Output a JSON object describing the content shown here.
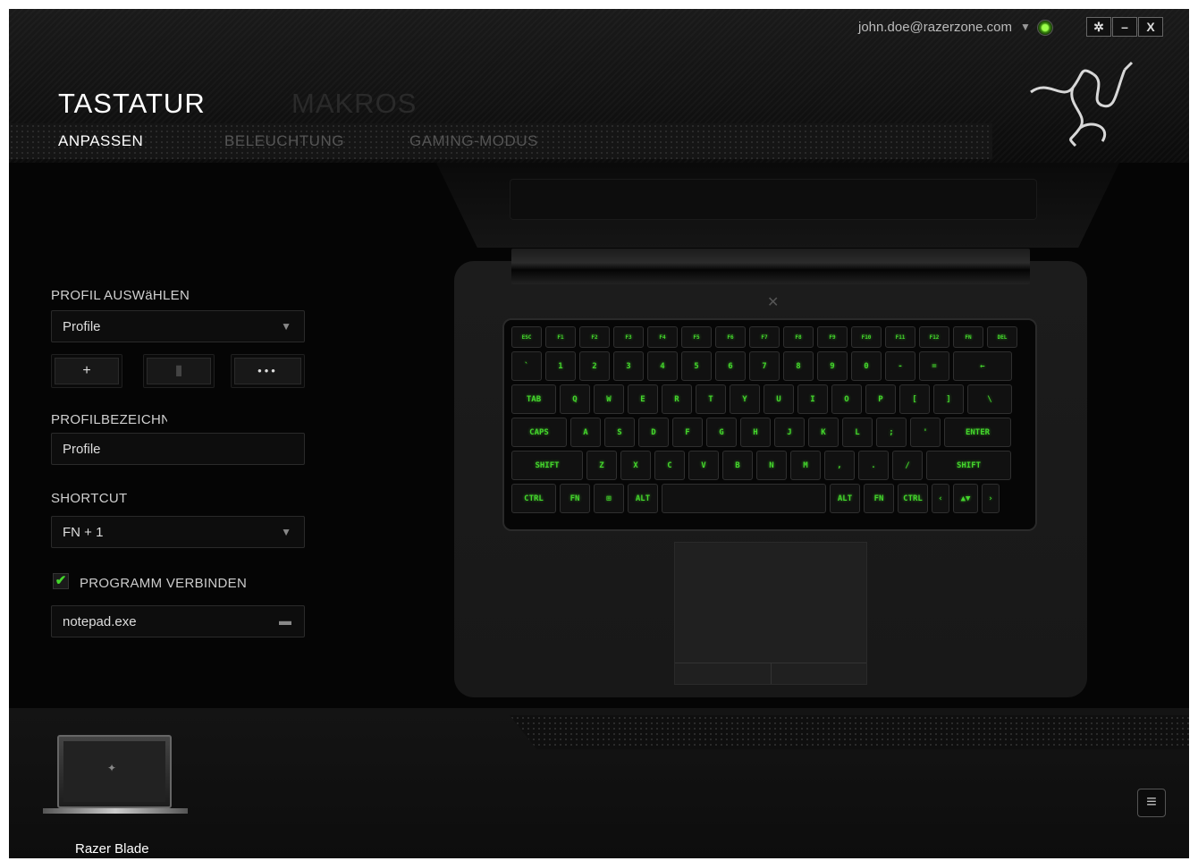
{
  "header": {
    "account": "john.doe@razerzone.com",
    "settings_icon": "gear-icon",
    "minimize_label": "–",
    "close_label": "X",
    "tabs": [
      "TASTATUR",
      "MAKROS"
    ],
    "subtabs": [
      "ANPASSEN",
      "BELEUCHTUNG",
      "GAMING-MODUS"
    ]
  },
  "profile": {
    "select_label": "PROFIL AUSWäHLEN",
    "selected_profile": "Profile",
    "add_label": "+",
    "delete_icon": "trash-icon",
    "more_label": "•••",
    "name_label": "PROFILBEZEICHNUNG",
    "name_value": "Profile",
    "shortcut_label": "SHORTCUT",
    "shortcut_value": "FN + 1",
    "link_program_label": "PROGRAMM VERBINDEN",
    "link_program_checked": true,
    "program_value": "notepad.exe",
    "folder_icon": "folder-icon"
  },
  "keyboard": {
    "rows": [
      [
        "esc",
        "f1",
        "f2",
        "f3",
        "f4",
        "f5",
        "f6",
        "f7",
        "f8",
        "f9",
        "f10",
        "f11",
        "f12",
        "fn",
        "del"
      ],
      [
        "`",
        "1",
        "2",
        "3",
        "4",
        "5",
        "6",
        "7",
        "8",
        "9",
        "0",
        "-",
        "=",
        "←"
      ],
      [
        "tab",
        "Q",
        "W",
        "E",
        "R",
        "T",
        "Y",
        "U",
        "I",
        "O",
        "P",
        "[",
        "]",
        "\\"
      ],
      [
        "caps",
        "A",
        "S",
        "D",
        "F",
        "G",
        "H",
        "J",
        "K",
        "L",
        ";",
        "'",
        "enter"
      ],
      [
        "shift",
        "Z",
        "X",
        "C",
        "V",
        "B",
        "N",
        "M",
        ",",
        ".",
        "/",
        "shift"
      ],
      [
        "ctrl",
        "fn",
        "⊞",
        "alt",
        "",
        "alt",
        "fn",
        "ctrl",
        "‹",
        "▲▼",
        "›"
      ]
    ],
    "accent": "#44d62c"
  },
  "footer": {
    "device_name": "Razer Blade",
    "menu_icon": "hamburger-icon"
  }
}
